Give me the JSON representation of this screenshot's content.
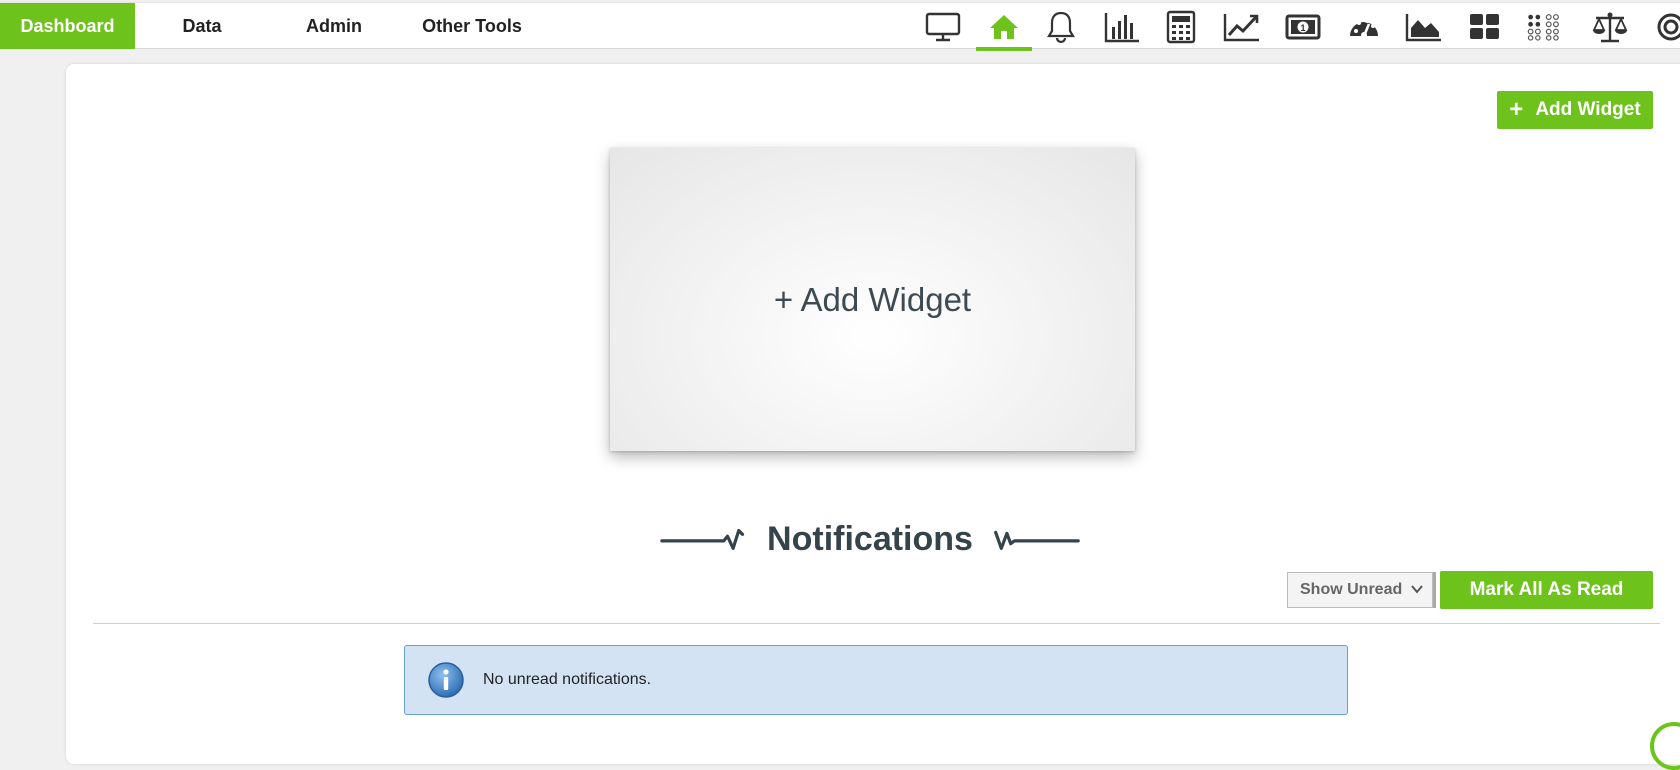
{
  "nav": {
    "tabs": [
      {
        "label": "Dashboard",
        "active": true
      },
      {
        "label": "Data"
      },
      {
        "label": "Admin"
      },
      {
        "label": "Other Tools"
      }
    ],
    "toolbar_icons": [
      "monitor-icon",
      "home-icon",
      "bell-icon",
      "bar-chart-icon",
      "calculator-icon",
      "line-chart-icon",
      "money-icon",
      "gauge-icon",
      "area-chart-icon",
      "grid-icon",
      "dots-icon",
      "scale-icon",
      "target-icon"
    ],
    "active_icon": "home-icon"
  },
  "dashboard": {
    "add_widget_button": "Add Widget",
    "widget_placeholder": "+ Add Widget"
  },
  "notifications": {
    "title": "Notifications",
    "filter_selected": "Show Unread",
    "mark_all_button": "Mark All As Read",
    "empty_message": "No unread notifications."
  },
  "colors": {
    "accent": "#6dc31c",
    "alert_bg": "#d3e3f4",
    "alert_border": "#6a9fd2",
    "heading": "#35434b"
  }
}
